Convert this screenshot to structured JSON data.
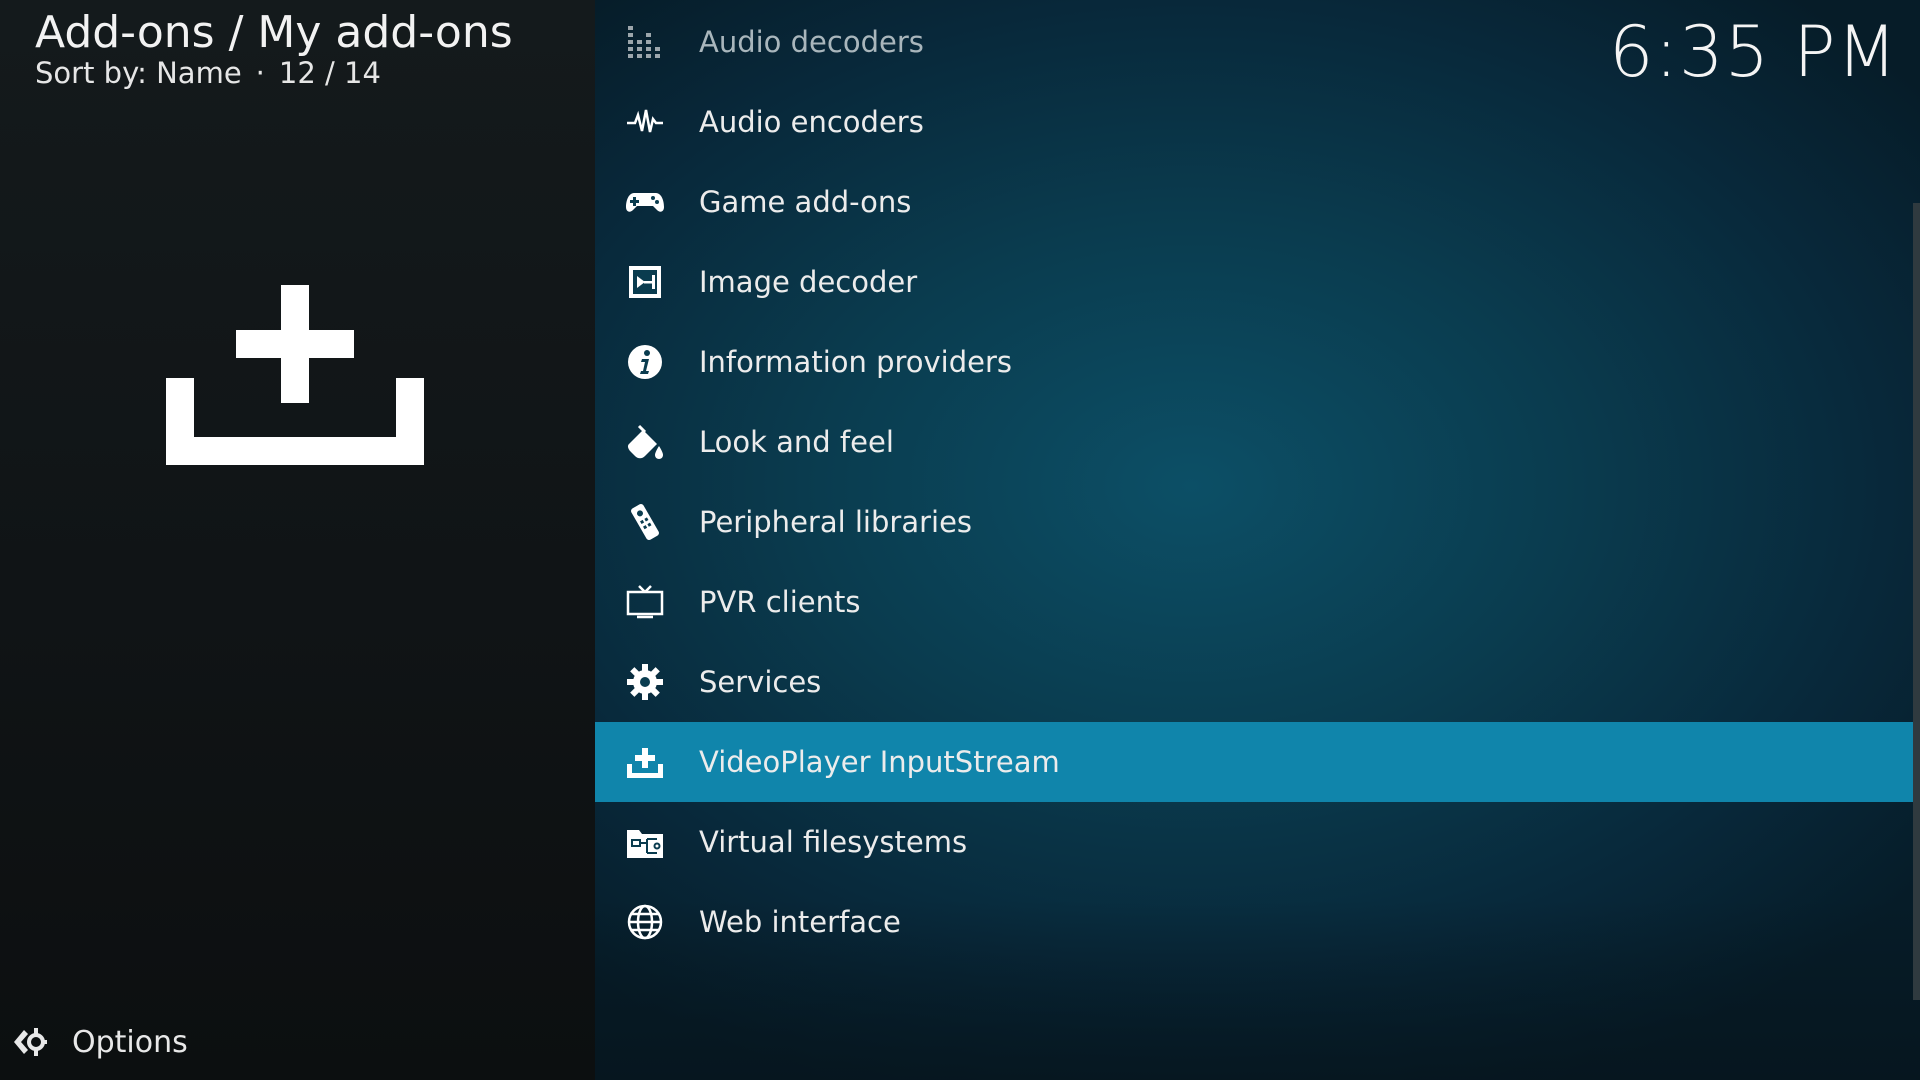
{
  "header": {
    "title": "Add-ons / My add-ons",
    "sort_label": "Sort by: Name",
    "separator": "·",
    "position": "12 / 14"
  },
  "clock": "6:35 PM",
  "options_label": "Options",
  "list": {
    "items": [
      {
        "label": "Audio decoders",
        "icon": "equalizer-icon"
      },
      {
        "label": "Audio encoders",
        "icon": "waveform-icon"
      },
      {
        "label": "Game add-ons",
        "icon": "gamepad-icon"
      },
      {
        "label": "Image decoder",
        "icon": "image-decoder-icon"
      },
      {
        "label": "Information providers",
        "icon": "info-icon"
      },
      {
        "label": "Look and feel",
        "icon": "paint-bucket-icon"
      },
      {
        "label": "Peripheral libraries",
        "icon": "remote-control-icon"
      },
      {
        "label": "PVR clients",
        "icon": "tv-icon"
      },
      {
        "label": "Services",
        "icon": "gear-icon"
      },
      {
        "label": "VideoPlayer InputStream",
        "icon": "inputstream-icon"
      },
      {
        "label": "Virtual filesystems",
        "icon": "filesystem-icon"
      },
      {
        "label": "Web interface",
        "icon": "globe-icon"
      }
    ],
    "selected": "VideoPlayer InputStream"
  },
  "colors": {
    "selected_row": "#1085ab",
    "panel_left": "#12171a",
    "panel_right": "#0a3c4f"
  }
}
